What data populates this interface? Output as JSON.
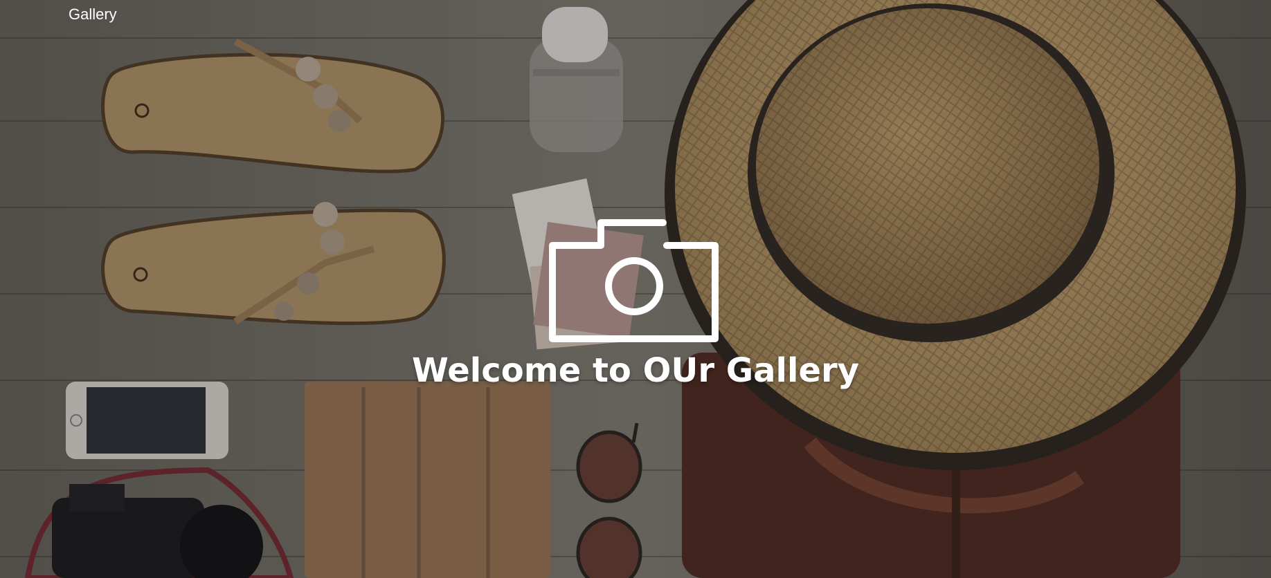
{
  "nav": {
    "brand": "Gallery"
  },
  "hero": {
    "title": "Welcome to OUr Gallery",
    "icon": "camera-icon",
    "background_objects": [
      "flip-flops",
      "water-bottle",
      "photos",
      "straw-hat",
      "leather-bag",
      "smartphone",
      "tablet-case",
      "sunglasses",
      "camera"
    ]
  },
  "colors": {
    "text": "#ffffff",
    "floor": "#6e6a63"
  }
}
